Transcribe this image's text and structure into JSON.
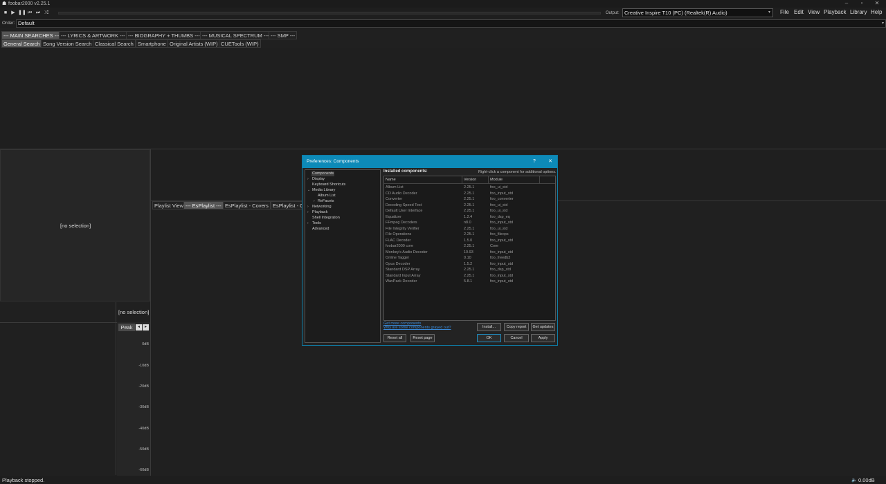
{
  "window": {
    "title": "foobar2000 v2.25.1"
  },
  "toolbar": {
    "output_label": "Output:",
    "output_device": "Creative Inspire T10 (PC) (Realtek(R) Audio)"
  },
  "menu": [
    "File",
    "Edit",
    "View",
    "Playback",
    "Library",
    "Help"
  ],
  "order": {
    "label": "Order:",
    "value": "Default"
  },
  "top_tabs": [
    "--- MAIN SEARCHES ---",
    "--- LYRICS & ARTWORK ---",
    "--- BIOGRAPHY + THUMBS ---",
    "--- MUSICAL SPECTRUM ---",
    "--- SMP ---"
  ],
  "search_tabs": [
    "General Search",
    "Song Version Search",
    "Classical Search",
    "Smartphone",
    "Original Artists (WIP)",
    "CUETools (WIP)"
  ],
  "left_panel": {
    "text": "[no selection]"
  },
  "small_panel": {
    "text": "[no selection]"
  },
  "playlist_tabs": [
    "Playlist View",
    "--- EsPlaylist ---",
    "EsPlaylist - Covers",
    "EsPlaylist - C"
  ],
  "vu": {
    "peak_label": "Peak",
    "ticks": [
      "0dB",
      "-10dB",
      "-20dB",
      "-30dB",
      "-40dB",
      "-50dB",
      "-60dB"
    ]
  },
  "status": {
    "text": "Playback stopped.",
    "volume": "0.00dB"
  },
  "dialog": {
    "title": "Preferences: Components",
    "help": "?",
    "close": "✕",
    "tree": {
      "components": "Components",
      "display": "Display",
      "keyboard": "Keyboard Shortcuts",
      "media_library": "Media Library",
      "album_list": "Album List",
      "refacets": "ReFacets",
      "networking": "Networking",
      "playback": "Playback",
      "shell": "Shell Integration",
      "tools": "Tools",
      "advanced": "Advanced"
    },
    "section_label": "Installed components:",
    "hint": "Right-click a component for additional options.",
    "columns": [
      "Name",
      "Version",
      "Module"
    ],
    "rows": [
      [
        "Album List",
        "2.25.1",
        "foo_ui_std"
      ],
      [
        "CD Audio Decoder",
        "2.25.1",
        "foo_input_std"
      ],
      [
        "Converter",
        "2.25.1",
        "foo_converter"
      ],
      [
        "Decoding Speed Test",
        "2.25.1",
        "foo_ui_std"
      ],
      [
        "Default User Interface",
        "2.25.1",
        "foo_ui_std"
      ],
      [
        "Equalizer",
        "1.2.4",
        "foo_dsp_eq"
      ],
      [
        "FFmpeg Decoders",
        "n8.0",
        "foo_input_std"
      ],
      [
        "File Integrity Verifier",
        "2.25.1",
        "foo_ui_std"
      ],
      [
        "File Operations",
        "2.25.1",
        "foo_fileops"
      ],
      [
        "FLAC Decoder",
        "1.5.0",
        "foo_input_std"
      ],
      [
        "foobar2000 core",
        "2.25.1",
        "Core"
      ],
      [
        "Monkey's Audio Decoder",
        "10.93",
        "foo_input_std"
      ],
      [
        "Online Tagger",
        "0.10",
        "foo_freedb2"
      ],
      [
        "Opus Decoder",
        "1.5.2",
        "foo_input_std"
      ],
      [
        "Standard DSP Array",
        "2.25.1",
        "foo_dsp_std"
      ],
      [
        "Standard Input Array",
        "2.25.1",
        "foo_input_std"
      ],
      [
        "WavPack Decoder",
        "5.8.1",
        "foo_input_std"
      ]
    ],
    "link_more": "Get more components",
    "link_grayed": "Why are some components grayed out?",
    "buttons": {
      "install": "Install...",
      "copy_report": "Copy report",
      "get_updates": "Get updates",
      "reset_all": "Reset all",
      "reset_page": "Reset page",
      "ok": "OK",
      "cancel": "Cancel",
      "apply": "Apply"
    }
  }
}
